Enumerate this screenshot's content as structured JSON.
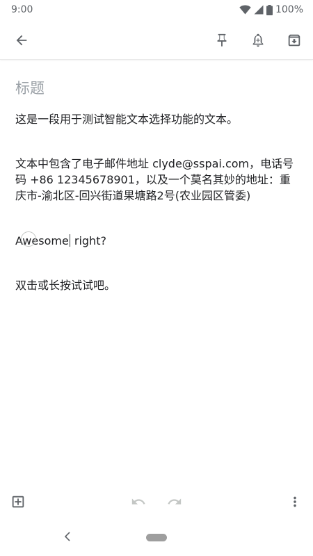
{
  "status_bar": {
    "time": "9:00",
    "battery": "100%"
  },
  "toolbar": {
    "icons": [
      "back-arrow-icon",
      "pin-icon",
      "reminder-bell-icon",
      "archive-icon"
    ]
  },
  "note": {
    "title_placeholder": "标题",
    "paragraphs": [
      "这是一段用于测试智能文本选择功能的文本。",
      "文本中包含了电子邮件地址 clyde@sspai.com，电话号码 +86 12345678901，以及一个莫名其妙的地址：重庆市-渝北区-回兴街道果塘路2号(农业园区管委)",
      "双击或长按试试吧。"
    ],
    "cursor_line": {
      "before_cursor": "Awesome",
      "after_cursor": " right?"
    }
  },
  "bottom_bar": {
    "icons": [
      "add-box-icon",
      "undo-icon",
      "redo-icon",
      "more-vert-icon"
    ]
  },
  "colors": {
    "icon": "#5f6368",
    "icon_disabled": "#c4c7c5",
    "text": "#202124",
    "placeholder": "#9aa0a6"
  }
}
